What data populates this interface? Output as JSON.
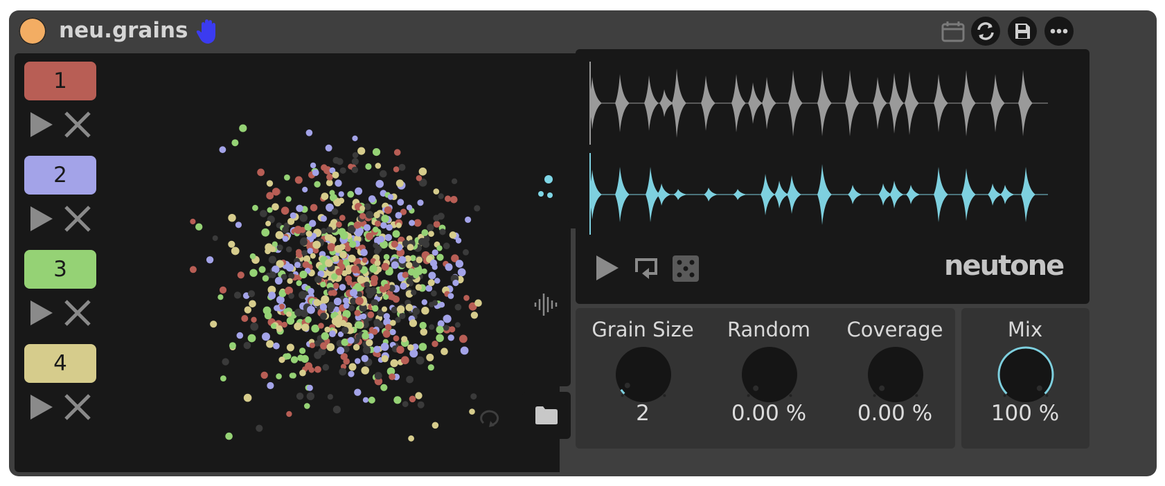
{
  "device": {
    "title": "neu.grains",
    "orb_color": "#f3ad63",
    "hand_icon_color": "#3b3bf0"
  },
  "toolbar": {
    "icons": [
      "calendar-icon",
      "sync-icon",
      "save-icon",
      "more-icon"
    ]
  },
  "slots": [
    {
      "label": "1",
      "color": "#b85e55"
    },
    {
      "label": "2",
      "color": "#a3a3e8"
    },
    {
      "label": "3",
      "color": "#95d275"
    },
    {
      "label": "4",
      "color": "#d6cc8c"
    }
  ],
  "scatter": {
    "palette": [
      "#b85e55",
      "#a3a3e8",
      "#95d275",
      "#d6cc8c",
      "#3a3a3a"
    ],
    "highlight_color": "#7fd6e6"
  },
  "waveform": {
    "top_color": "#9a9a9a",
    "bottom_color": "#7ed0df",
    "controls": [
      "play-icon",
      "loop-icon",
      "dice-icon"
    ]
  },
  "brand": "neutone",
  "knobs": [
    {
      "label": "Grain Size",
      "value": "2",
      "fraction": 0.04
    },
    {
      "label": "Random",
      "value": "0.00 %",
      "fraction": 0
    },
    {
      "label": "Coverage",
      "value": "0.00 %",
      "fraction": 0
    }
  ],
  "mix": {
    "label": "Mix",
    "value": "100 %",
    "fraction": 1.0
  },
  "accent": "#7ed0df"
}
